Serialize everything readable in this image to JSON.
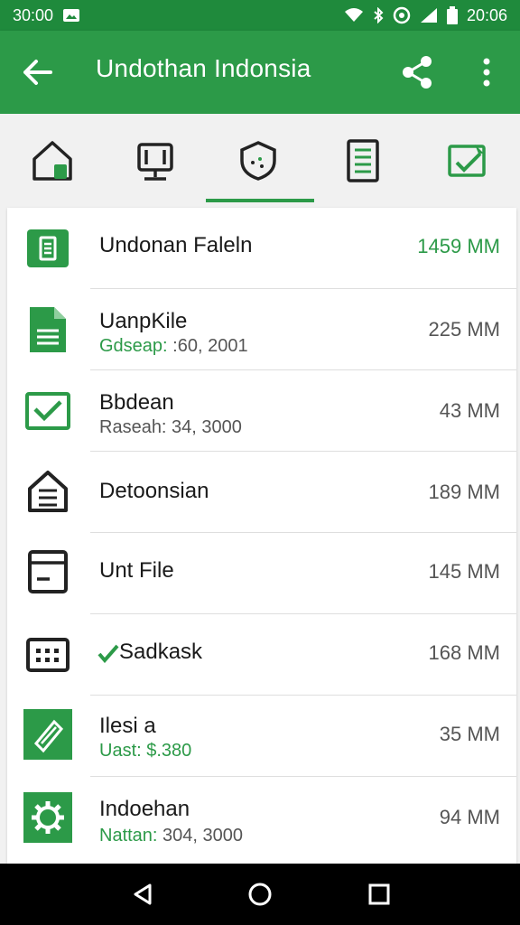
{
  "status": {
    "time_left": "30:00",
    "time_right": "20:06"
  },
  "app_bar": {
    "title": "Undothan Indonsia"
  },
  "tabs": [
    {
      "icon": "home-icon"
    },
    {
      "icon": "monitor-icon"
    },
    {
      "icon": "shield-icon"
    },
    {
      "icon": "document-list-icon"
    },
    {
      "icon": "mail-check-icon"
    }
  ],
  "files": [
    {
      "icon": "folder-doc-icon",
      "name": "Undonan Faleln",
      "sub_key": "",
      "sub_val": "",
      "size": "1459 MM",
      "size_color": "#2c9a48"
    },
    {
      "icon": "document-icon",
      "name": "UanpKile",
      "sub_key": "Gdsеар:",
      "sub_val": " :60, 2001",
      "size": "225 MM",
      "size_color": "#555555"
    },
    {
      "icon": "email-check-icon",
      "name": "Bbdean",
      "sub_key": "",
      "sub_val": "Raseah: 34, 3000",
      "size": "43 MM",
      "size_color": "#555555"
    },
    {
      "icon": "house-icon",
      "name": "Detoonsian",
      "sub_key": "",
      "sub_val": "",
      "size": "189 MM",
      "size_color": "#555555"
    },
    {
      "icon": "file-outline-icon",
      "name": "Unt File",
      "sub_key": "",
      "sub_val": "",
      "size": "145 MM",
      "size_color": "#555555"
    },
    {
      "icon": "keyboard-icon",
      "name": "Sadkask",
      "sub_key": "",
      "sub_val": "",
      "size": "168 MM",
      "size_color": "#555555",
      "check": true
    },
    {
      "icon": "tag-icon",
      "name": "Ilesi a",
      "sub_key": "Uast:",
      "sub_val": " $.380",
      "size": "35 MM",
      "size_color": "#555555"
    },
    {
      "icon": "gear-icon",
      "name": "Indoehan",
      "sub_key": "Nattan:",
      "sub_val": " 304, 3000",
      "size": "94 MM",
      "size_color": "#555555"
    }
  ],
  "colors": {
    "primary": "#2c9a48",
    "status_bar": "#1f8a3c"
  }
}
